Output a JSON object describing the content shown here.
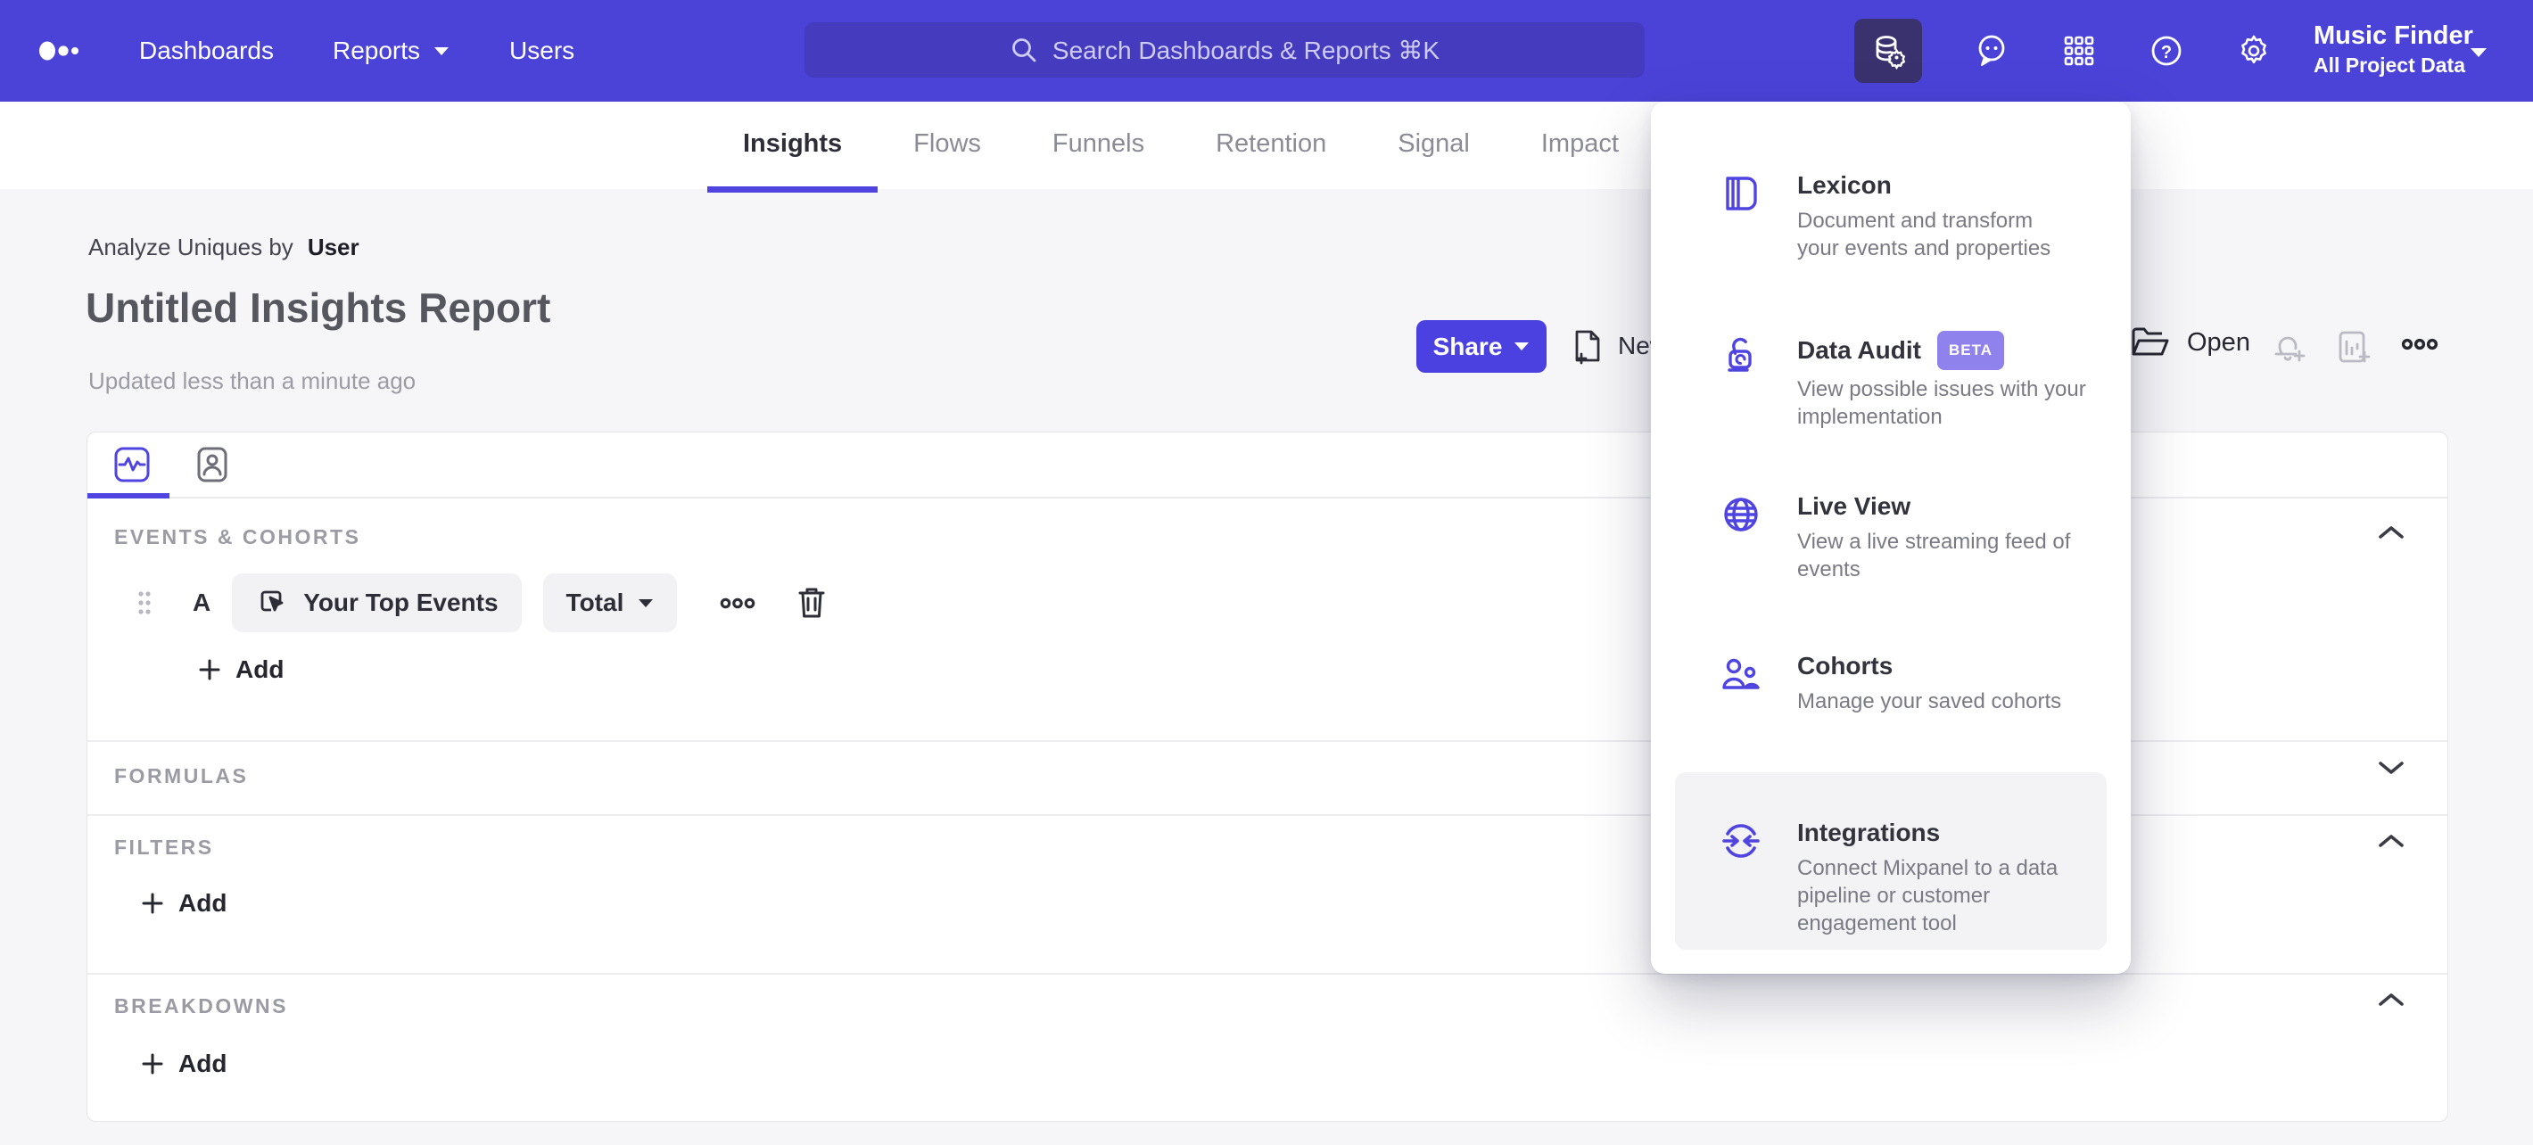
{
  "nav": {
    "dashboards": "Dashboards",
    "reports": "Reports",
    "users": "Users",
    "search_placeholder": "Search Dashboards & Reports ⌘K",
    "project_name": "Music Finder",
    "project_scope": "All Project Data"
  },
  "tabs": {
    "insights": "Insights",
    "flows": "Flows",
    "funnels": "Funnels",
    "retention": "Retention",
    "signal": "Signal",
    "impact": "Impact"
  },
  "report": {
    "analyze_label": "Analyze Uniques by",
    "analyze_value": "User",
    "title": "Untitled Insights Report",
    "updated": "Updated less than a minute ago"
  },
  "actions": {
    "share": "Share",
    "new": "New",
    "open": "Open"
  },
  "builder": {
    "events_header": "EVENTS & COHORTS",
    "formulas_header": "FORMULAS",
    "filters_header": "FILTERS",
    "breakdowns_header": "BREAKDOWNS",
    "add": "Add",
    "row_letter": "A",
    "event_name": "Your Top Events",
    "metric": "Total"
  },
  "menu": {
    "items": [
      {
        "title": "Lexicon",
        "description": "Document and transform your events and properties"
      },
      {
        "title": "Data Audit",
        "badge": "BETA",
        "description": "View possible issues with your implementation"
      },
      {
        "title": "Live View",
        "description": "View a live streaming feed of events"
      },
      {
        "title": "Cohorts",
        "description": "Manage your saved cohorts"
      },
      {
        "title": "Integrations",
        "description": "Connect Mixpanel to a data pipeline or customer engagement tool"
      }
    ]
  },
  "colors": {
    "nav_bg": "#4b43d8",
    "accent": "#4f44e0",
    "beta_badge": "#8f82ec",
    "active_tile": "#3a326f"
  }
}
